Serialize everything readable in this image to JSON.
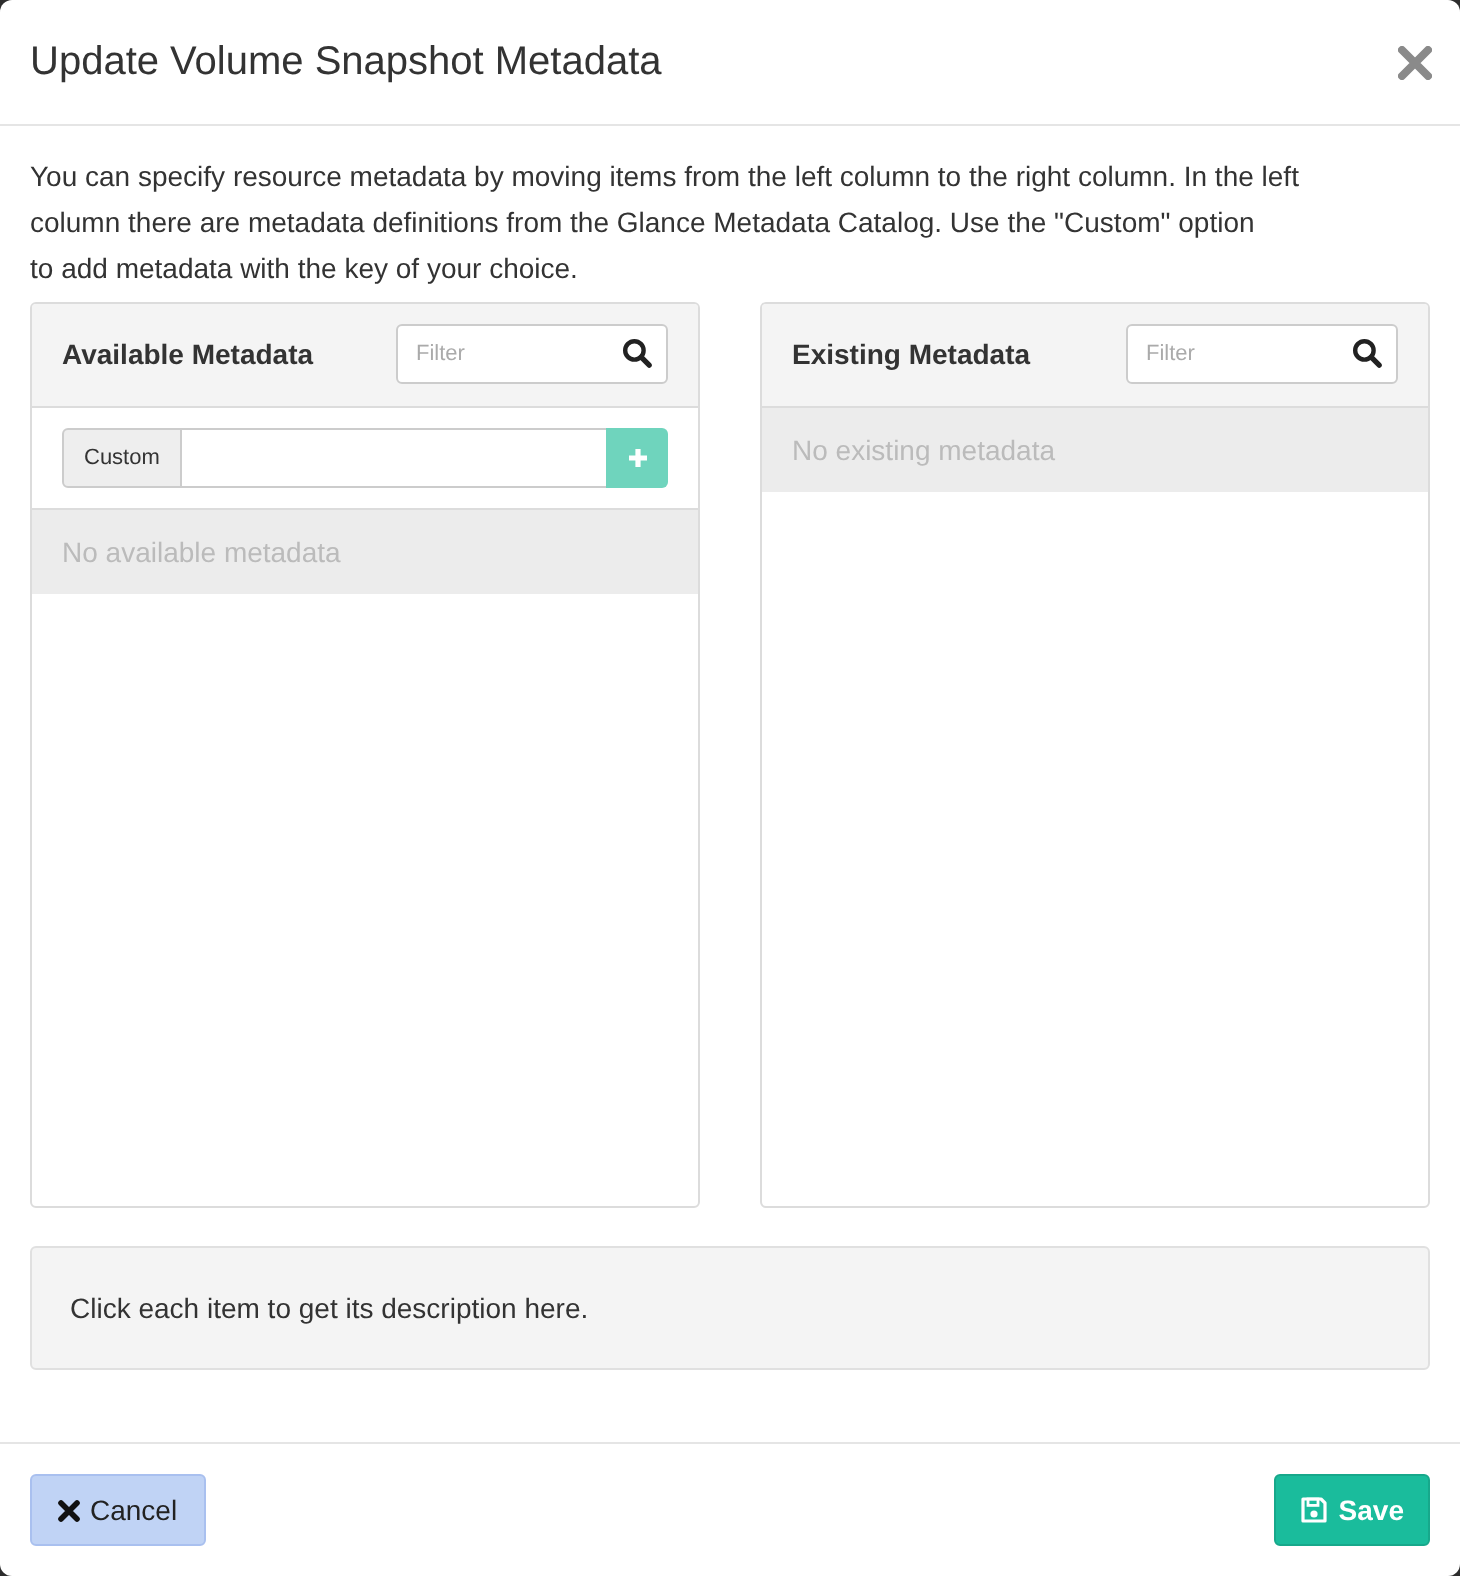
{
  "dialog": {
    "title": "Update Volume Snapshot Metadata"
  },
  "description": "You can specify resource metadata by moving items from the left column to the right column. In the left\ncolumn there are metadata definitions from the Glance Metadata Catalog. Use the \"Custom\" option\nto add metadata with the key of your choice.",
  "panels": [
    {
      "title": "Available Metadata",
      "filter": {
        "placeholder": "Filter"
      },
      "custom": {
        "label": "Custom",
        "add_disabled": true
      },
      "empty_message": "No available metadata"
    },
    {
      "title": "Existing Metadata",
      "filter": {
        "placeholder": "Filter"
      },
      "empty_message": "No existing metadata"
    }
  ],
  "info_box": "Click each item to get its description here.",
  "buttons": [
    {
      "label": "Cancel",
      "kind": "cancel"
    },
    {
      "label": "Save",
      "kind": "save"
    }
  ]
}
